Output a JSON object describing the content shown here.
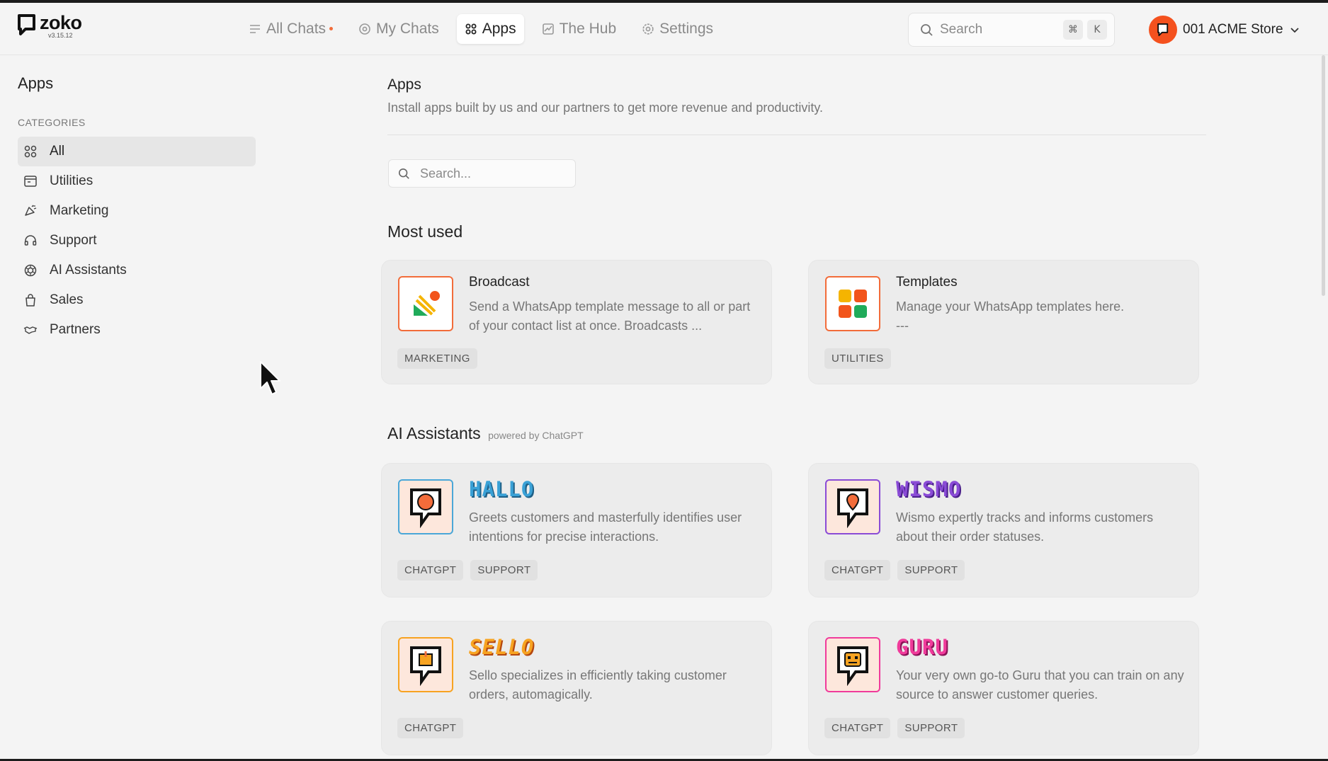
{
  "app": {
    "name": "zoko",
    "version": "v3.15.12"
  },
  "nav": [
    {
      "label": "All Chats",
      "icon": "list-icon",
      "active": false
    },
    {
      "label": "My Chats",
      "icon": "at-icon",
      "active": false
    },
    {
      "label": "Apps",
      "icon": "grid-icon",
      "active": true
    },
    {
      "label": "The Hub",
      "icon": "chart-icon",
      "active": false
    },
    {
      "label": "Settings",
      "icon": "gear-icon",
      "active": false
    }
  ],
  "top_search": {
    "placeholder": "Search",
    "shortcut_mod": "⌘",
    "shortcut_key": "K"
  },
  "store": {
    "name": "001 ACME Store"
  },
  "sidebar": {
    "title": "Apps",
    "categories_label": "CATEGORIES",
    "items": [
      {
        "label": "All",
        "icon": "grid-icon",
        "active": true
      },
      {
        "label": "Utilities",
        "icon": "toolbox-icon",
        "active": false
      },
      {
        "label": "Marketing",
        "icon": "megaphone-icon",
        "active": false
      },
      {
        "label": "Support",
        "icon": "headset-icon",
        "active": false
      },
      {
        "label": "AI Assistants",
        "icon": "openai-icon",
        "active": false
      },
      {
        "label": "Sales",
        "icon": "shopping-bag-icon",
        "active": false
      },
      {
        "label": "Partners",
        "icon": "handshake-icon",
        "active": false
      }
    ]
  },
  "main": {
    "title": "Apps",
    "subtitle": "Install apps built by us and our partners to get more revenue and productivity.",
    "search_placeholder": "Search...",
    "most_used": {
      "heading": "Most used",
      "cards": [
        {
          "title": "Broadcast",
          "desc": "Send a WhatsApp template message to all or part of your contact list at once. Broadcasts ...",
          "tags": [
            "MARKETING"
          ]
        },
        {
          "title": "Templates",
          "desc": "Manage your WhatsApp templates here.",
          "desc2": "---",
          "tags": [
            "UTILITIES"
          ]
        }
      ]
    },
    "ai": {
      "heading": "AI Assistants",
      "powered": "powered by ChatGPT",
      "cards": [
        {
          "title": "HALLO",
          "desc": "Greets customers and masterfully identifies user intentions for precise interactions.",
          "tags": [
            "CHATGPT",
            "SUPPORT"
          ]
        },
        {
          "title": "WISMO",
          "desc": "Wismo expertly tracks and informs customers about their order statuses.",
          "tags": [
            "CHATGPT",
            "SUPPORT"
          ]
        },
        {
          "title": "SELLO",
          "desc": "Sello specializes in efficiently taking customer orders, automagically.",
          "tags": [
            "CHATGPT"
          ]
        },
        {
          "title": "GURU",
          "desc": "Your very own go-to Guru that you can train on any source to answer customer queries.",
          "tags": [
            "CHATGPT",
            "SUPPORT"
          ]
        }
      ]
    }
  },
  "colors": {
    "accent": "#f4511e",
    "background": "#f4f4f4",
    "card": "#ececec"
  }
}
